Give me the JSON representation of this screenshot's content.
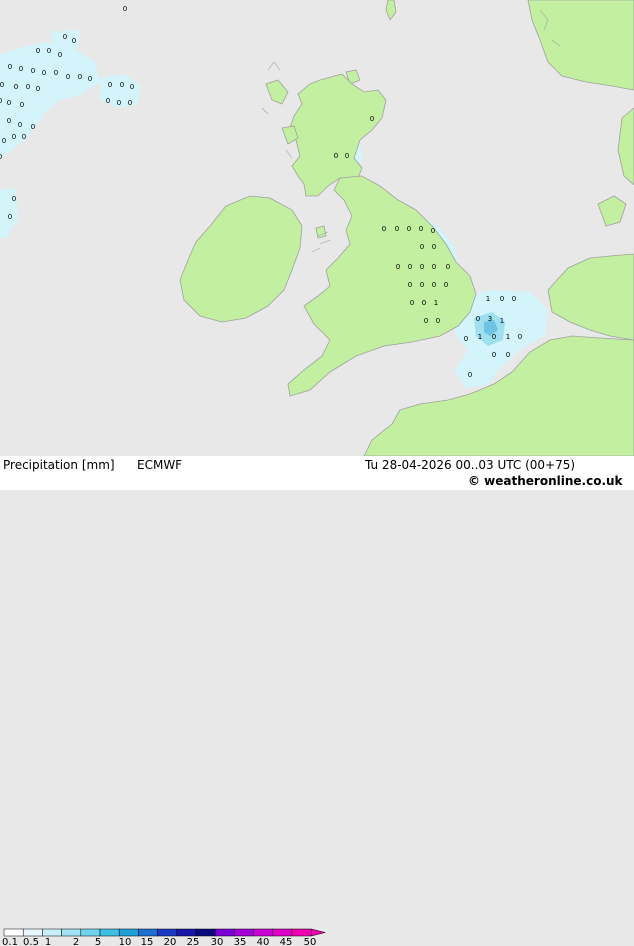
{
  "footer": {
    "title": "Precipitation [mm]",
    "model": "ECMWF",
    "datetime": "Tu 28-04-2026 00..03 UTC (00+75)",
    "credit": "© weatheronline.co.uk"
  },
  "legend": {
    "colors": [
      "#ffffff",
      "#e6f8fd",
      "#c8eff9",
      "#9fe2f3",
      "#6fd3ec",
      "#3cbfe3",
      "#1e9fd8",
      "#1a6fcf",
      "#1a3ac4",
      "#1616a8",
      "#0a0a7a",
      "#7a00d6",
      "#a400d9",
      "#cc00d6",
      "#e000c8",
      "#f000b0"
    ],
    "labels": [
      "0.1",
      "0.5",
      "1",
      "2",
      "5",
      "10",
      "15",
      "20",
      "25",
      "30",
      "35",
      "40",
      "45",
      "50"
    ]
  },
  "colors": {
    "sea": "#e8e8e8",
    "land": "#c2f0a0",
    "coast": "#a0a0a0",
    "precip_light": "#d2f4fa",
    "precip_medium": "#9fe0f0",
    "precip_heavy": "#6fc4e6"
  },
  "map_points": [
    {
      "text": "0"
    },
    {
      "text": "0"
    },
    {
      "text": "0"
    },
    {
      "text": "0"
    },
    {
      "text": "0"
    },
    {
      "text": "0"
    },
    {
      "text": "0"
    },
    {
      "text": "0"
    },
    {
      "text": "0"
    },
    {
      "text": "0"
    },
    {
      "text": "0"
    },
    {
      "text": "0"
    },
    {
      "text": "0"
    },
    {
      "text": "0"
    },
    {
      "text": "0"
    },
    {
      "text": "0"
    },
    {
      "text": "0"
    },
    {
      "text": "0"
    },
    {
      "text": "0"
    },
    {
      "text": "0"
    },
    {
      "text": "0"
    },
    {
      "text": "0"
    },
    {
      "text": "0"
    },
    {
      "text": "0"
    },
    {
      "text": "0"
    },
    {
      "text": "0"
    },
    {
      "text": "0"
    },
    {
      "text": "0"
    },
    {
      "text": "0"
    },
    {
      "text": "0"
    },
    {
      "text": "0"
    },
    {
      "text": "0"
    },
    {
      "text": "0"
    },
    {
      "text": "0"
    },
    {
      "text": "0"
    },
    {
      "text": "0"
    },
    {
      "text": "0"
    },
    {
      "text": "0"
    },
    {
      "text": "0"
    },
    {
      "text": "0"
    },
    {
      "text": "0"
    },
    {
      "text": "0"
    },
    {
      "text": "0"
    },
    {
      "text": "0"
    },
    {
      "text": "0"
    },
    {
      "text": "0"
    },
    {
      "text": "0"
    },
    {
      "text": "0"
    },
    {
      "text": "0"
    },
    {
      "text": "0"
    },
    {
      "text": "0"
    },
    {
      "text": "0"
    },
    {
      "text": "0"
    },
    {
      "text": "0"
    },
    {
      "text": "0"
    },
    {
      "text": "1"
    },
    {
      "text": "0"
    },
    {
      "text": "0"
    },
    {
      "text": "0"
    },
    {
      "text": "0"
    },
    {
      "text": "1"
    },
    {
      "text": "0"
    },
    {
      "text": "3"
    },
    {
      "text": "1"
    },
    {
      "text": "0"
    },
    {
      "text": "0"
    },
    {
      "text": "0"
    },
    {
      "text": "1"
    },
    {
      "text": "0"
    },
    {
      "text": "1"
    },
    {
      "text": "0"
    },
    {
      "text": "0"
    },
    {
      "text": "0"
    },
    {
      "text": "0"
    }
  ]
}
